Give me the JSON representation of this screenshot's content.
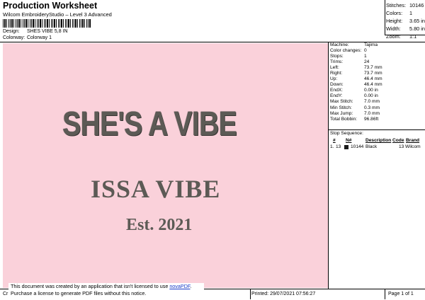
{
  "header": {
    "title": "Production Worksheet",
    "subtitle": "Wilcom EmbroideryStudio – Level 3 Advanced"
  },
  "design_info": {
    "design_key": "Design:",
    "design_value": "SHES VIBE 5,8 IN",
    "colorway_key": "Colorway:",
    "colorway_value": "Colorway 1"
  },
  "stats": [
    {
      "k": "Stitches:",
      "v": "10146"
    },
    {
      "k": "Colors:",
      "v": "1"
    },
    {
      "k": "Height:",
      "v": "3.65 in"
    },
    {
      "k": "Width:",
      "v": "5.80 in"
    },
    {
      "k": "Zoom:",
      "v": "1:1"
    }
  ],
  "design_text": {
    "line1": "SHE'S A VIBE",
    "line2": "ISSA VIBE",
    "line3": "Est. 2021"
  },
  "machine": [
    {
      "k": "Machine:",
      "v": "Tajima"
    },
    {
      "k": "Color changes:",
      "v": "0"
    },
    {
      "k": "Stops:",
      "v": "1"
    },
    {
      "k": "Trims:",
      "v": "24"
    },
    {
      "k": "Left:",
      "v": "73.7 mm"
    },
    {
      "k": "Right:",
      "v": "73.7 mm"
    },
    {
      "k": "Up:",
      "v": "46.4 mm"
    },
    {
      "k": "Down:",
      "v": "46.4 mm"
    },
    {
      "k": "EndX:",
      "v": "0.00 in"
    },
    {
      "k": "EndY:",
      "v": "0.00 in"
    },
    {
      "k": "Max Stitch:",
      "v": "7.0 mm"
    },
    {
      "k": "Min Stitch:",
      "v": "0.3 mm"
    },
    {
      "k": "Max Jump:",
      "v": "7.0 mm"
    },
    {
      "k": "Total Bobbin:",
      "v": "96.86ft"
    }
  ],
  "stop_sequence": {
    "title": "Stop Sequence:",
    "headers": {
      "num": "#",
      "n": "N#",
      "desc": "Description",
      "code": "Code",
      "brand": "Brand"
    },
    "rows": [
      {
        "index": "1.",
        "num": "13",
        "stitches": "10144",
        "desc": "Black",
        "code": "13",
        "brand": "Wilcom",
        "color": "#1a1a1a"
      }
    ]
  },
  "footer": {
    "left": "Cr",
    "printed": "Printed: 29/07/2021 07:56:27",
    "page": "Page 1 of 1"
  },
  "notice": {
    "line1_pre": "This document was created by an application that isn't licensed to use ",
    "link": "novaPDF",
    "line1_post": ".",
    "line2": "Purchase a license to generate PDF files without this notice."
  }
}
